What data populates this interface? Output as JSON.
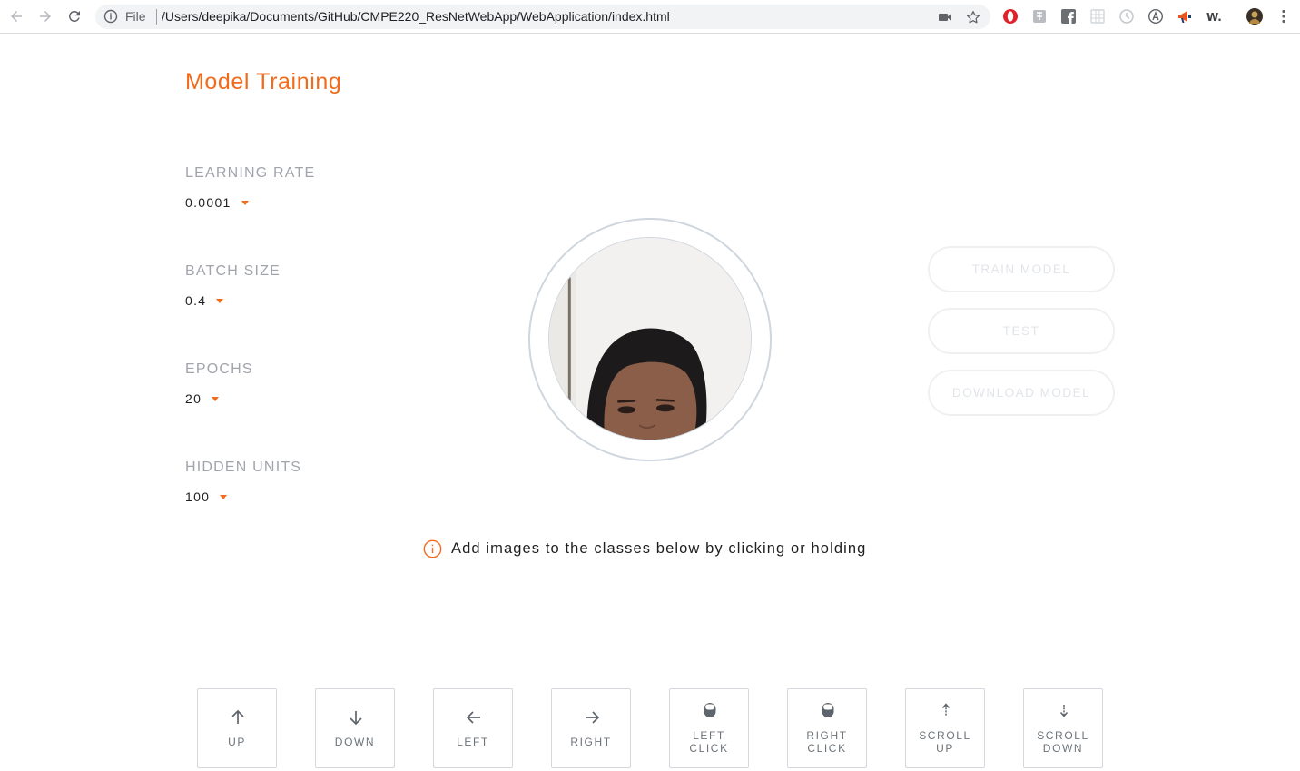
{
  "browser": {
    "scheme": "File",
    "url": "/Users/deepika/Documents/GitHub/CMPE220_ResNetWebApp/WebApplication/index.html",
    "extensions": [
      "opera-icon",
      "hanzi-icon",
      "facebook-icon",
      "grid-extension-icon",
      "clock-extension-icon",
      "a-extension-icon",
      "megaphone-icon",
      "w-extension-icon",
      "profile-avatar"
    ]
  },
  "page": {
    "title": "Model Training",
    "accent_color": "#f26b1d"
  },
  "params": [
    {
      "label": "LEARNING RATE",
      "value": "0.0001"
    },
    {
      "label": "BATCH SIZE",
      "value": "0.4"
    },
    {
      "label": "EPOCHS",
      "value": "20"
    },
    {
      "label": "HIDDEN UNITS",
      "value": "100"
    }
  ],
  "actions": {
    "train": "TRAIN MODEL",
    "test": "TEST",
    "download": "DOWNLOAD MODEL"
  },
  "hint": "Add images to the classes below by clicking or holding",
  "controls": [
    {
      "line1": "UP",
      "line2": "",
      "icon": "arrow-up-icon"
    },
    {
      "line1": "DOWN",
      "line2": "",
      "icon": "arrow-down-icon"
    },
    {
      "line1": "LEFT",
      "line2": "",
      "icon": "arrow-left-icon"
    },
    {
      "line1": "RIGHT",
      "line2": "",
      "icon": "arrow-right-icon"
    },
    {
      "line1": "LEFT",
      "line2": "CLICK",
      "icon": "mouse-left-icon"
    },
    {
      "line1": "RIGHT",
      "line2": "CLICK",
      "icon": "mouse-right-icon"
    },
    {
      "line1": "SCROLL",
      "line2": "UP",
      "icon": "scroll-up-icon"
    },
    {
      "line1": "SCROLL",
      "line2": "DOWN",
      "icon": "scroll-down-icon"
    }
  ]
}
